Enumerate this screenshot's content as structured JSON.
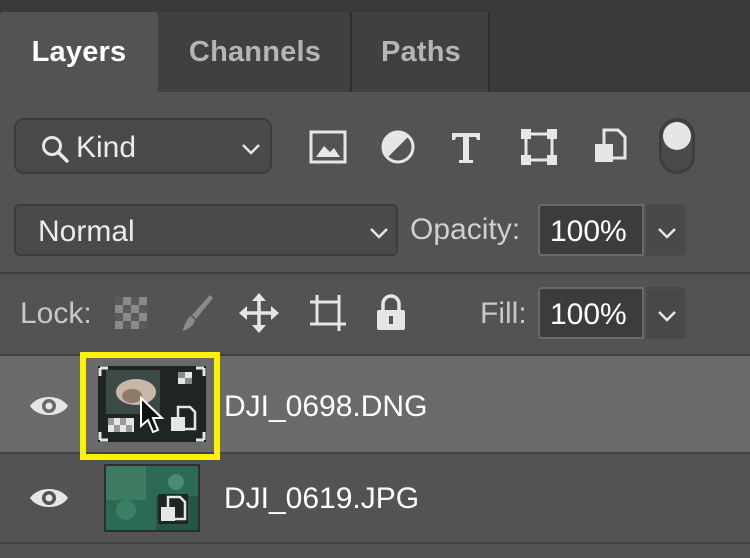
{
  "tabs": [
    {
      "label": "Layers",
      "active": true
    },
    {
      "label": "Channels",
      "active": false
    },
    {
      "label": "Paths",
      "active": false
    }
  ],
  "filter": {
    "kind_label": "Kind",
    "icons": [
      "image-filter-icon",
      "adjustment-filter-icon",
      "type-filter-icon",
      "shape-filter-icon",
      "smart-object-filter-icon"
    ]
  },
  "blend": {
    "mode": "Normal",
    "opacity_label": "Opacity:",
    "opacity_value": "100%"
  },
  "lock": {
    "label": "Lock:",
    "fill_label": "Fill:",
    "fill_value": "100%"
  },
  "layers": [
    {
      "name": "DJI_0698.DNG",
      "selected": true
    },
    {
      "name": "DJI_0619.JPG",
      "selected": false
    }
  ],
  "colors": {
    "panel_bg": "#535353",
    "tab_bar": "#3a3a3a",
    "selected_row": "#6a6a6a",
    "highlight": "#fff200"
  }
}
